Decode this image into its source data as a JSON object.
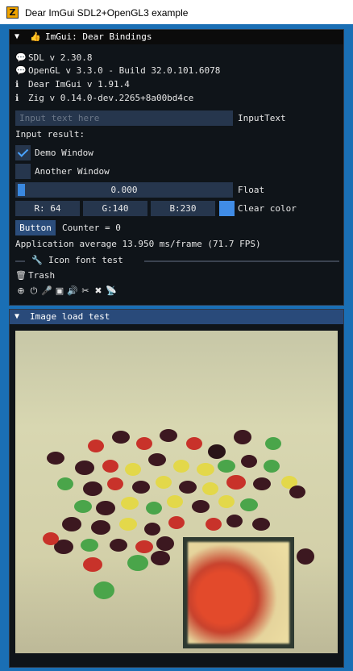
{
  "os_window": {
    "title": "Dear ImGui SDL2+OpenGL3 example",
    "app_icon_letter": "Z"
  },
  "main_window": {
    "title": "ImGui: Dear Bindings",
    "info": [
      {
        "icon": "comment-icon",
        "text": "SDL v 2.30.8"
      },
      {
        "icon": "comment-icon",
        "text": "OpenGL v 3.3.0 - Build 32.0.101.6078"
      },
      {
        "icon": "info-icon",
        "text": "Dear ImGui v 1.91.4"
      },
      {
        "icon": "info-icon",
        "text": "Zig v 0.14.0-dev.2265+8a00bd4ce"
      }
    ],
    "input": {
      "placeholder": "Input text here",
      "label": "InputText"
    },
    "input_result_label": "Input result:",
    "checkboxes": [
      {
        "label": "Demo Window",
        "checked": true
      },
      {
        "label": "Another Window",
        "checked": false
      }
    ],
    "float_slider": {
      "value": "0.000",
      "label": "Float"
    },
    "color": {
      "r": "R: 64",
      "g": "G:140",
      "b": "B:230",
      "label": "Clear color",
      "swatch": "#408ce6"
    },
    "button": {
      "label": "Button",
      "counter": "Counter = 0"
    },
    "perf": "Application average 13.950 ms/frame (71.7 FPS)",
    "icon_font": {
      "title": "Icon font test",
      "trash_label": "Trash"
    },
    "icon_row": [
      "search-plus-icon",
      "power-icon",
      "microphone-icon",
      "microchip-icon",
      "volume-icon",
      "scissors-icon",
      "tools-icon",
      "satellite-dish-icon"
    ]
  },
  "image_window": {
    "title": "Image load test"
  },
  "colors": {
    "accent": "#4a8fdc",
    "frame_bg": "#26364d",
    "title_active": "#294a7a",
    "window_bg": "#0f1419"
  }
}
